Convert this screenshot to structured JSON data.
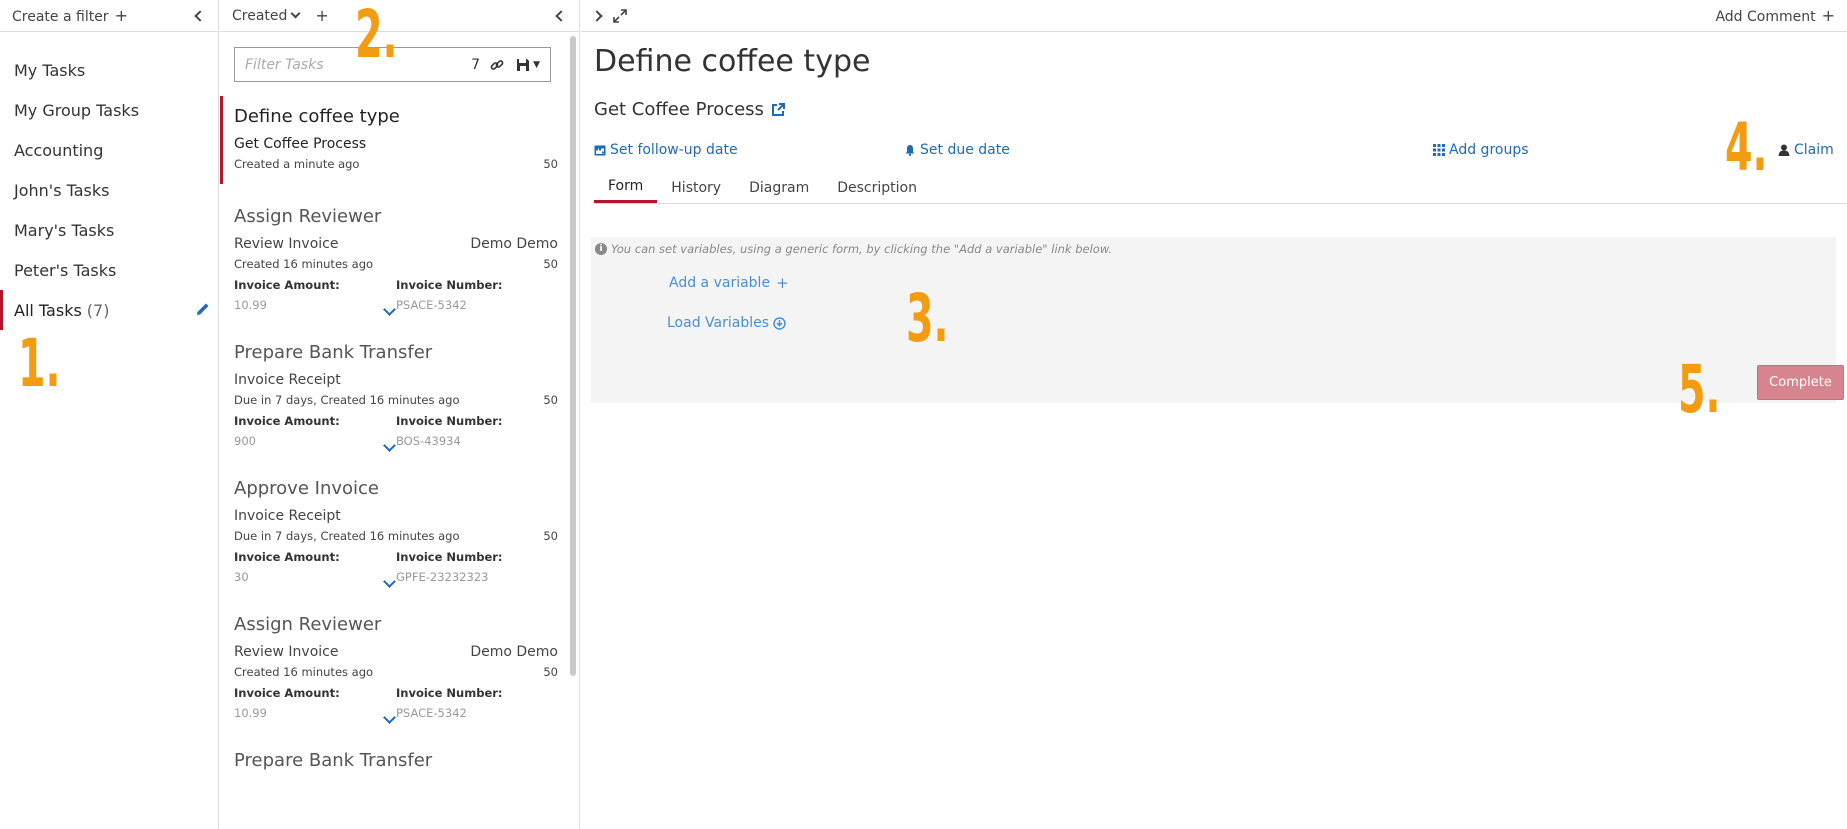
{
  "filters": {
    "create_label": "Create a filter",
    "items": [
      {
        "label": "My Tasks"
      },
      {
        "label": "My Group Tasks"
      },
      {
        "label": "Accounting"
      },
      {
        "label": "John's Tasks"
      },
      {
        "label": "Mary's Tasks"
      },
      {
        "label": "Peter's Tasks"
      },
      {
        "label": "All Tasks",
        "count": "(7)"
      }
    ]
  },
  "tasklist": {
    "sort_label": "Created",
    "filter_placeholder": "Filter Tasks",
    "count": "7",
    "tasks": [
      {
        "name": "Define coffee type",
        "process": "Get Coffee Process",
        "assignee": "",
        "meta": "Created a minute ago",
        "priority": "50"
      },
      {
        "name": "Assign Reviewer",
        "process": "Review Invoice",
        "assignee": "Demo Demo",
        "meta": "Created 16 minutes ago",
        "priority": "50",
        "var1_label": "Invoice Amount:",
        "var1_value": "10.99",
        "var2_label": "Invoice Number:",
        "var2_value": "PSACE-5342"
      },
      {
        "name": "Prepare Bank Transfer",
        "process": "Invoice Receipt",
        "assignee": "",
        "meta": "Due in 7 days, Created 16 minutes ago",
        "priority": "50",
        "var1_label": "Invoice Amount:",
        "var1_value": "900",
        "var2_label": "Invoice Number:",
        "var2_value": "BOS-43934"
      },
      {
        "name": "Approve Invoice",
        "process": "Invoice Receipt",
        "assignee": "",
        "meta": "Due in 7 days, Created 16 minutes ago",
        "priority": "50",
        "var1_label": "Invoice Amount:",
        "var1_value": "30",
        "var2_label": "Invoice Number:",
        "var2_value": "GPFE-23232323"
      },
      {
        "name": "Assign Reviewer",
        "process": "Review Invoice",
        "assignee": "Demo Demo",
        "meta": "Created 16 minutes ago",
        "priority": "50",
        "var1_label": "Invoice Amount:",
        "var1_value": "10.99",
        "var2_label": "Invoice Number:",
        "var2_value": "PSACE-5342"
      },
      {
        "name": "Prepare Bank Transfer"
      }
    ]
  },
  "detail": {
    "add_comment_label": "Add Comment",
    "title": "Define coffee type",
    "process_name": "Get Coffee Process",
    "followup_label": "Set follow-up date",
    "due_label": "Set due date",
    "groups_label": "Add groups",
    "claim_label": "Claim",
    "tabs": [
      {
        "label": "Form"
      },
      {
        "label": "History"
      },
      {
        "label": "Diagram"
      },
      {
        "label": "Description"
      }
    ],
    "form_hint": "You can set variables, using a generic form, by clicking the \"Add a variable\" link below.",
    "add_variable_label": "Add a variable",
    "load_variables_label": "Load Variables",
    "complete_label": "Complete"
  },
  "annotations": [
    "1.",
    "2.",
    "3.",
    "4.",
    "5."
  ],
  "colors": {
    "accent": "#b5152b",
    "link": "#1f6ab5",
    "annotation": "#f39c12",
    "complete_disabled": "#d8848f"
  }
}
